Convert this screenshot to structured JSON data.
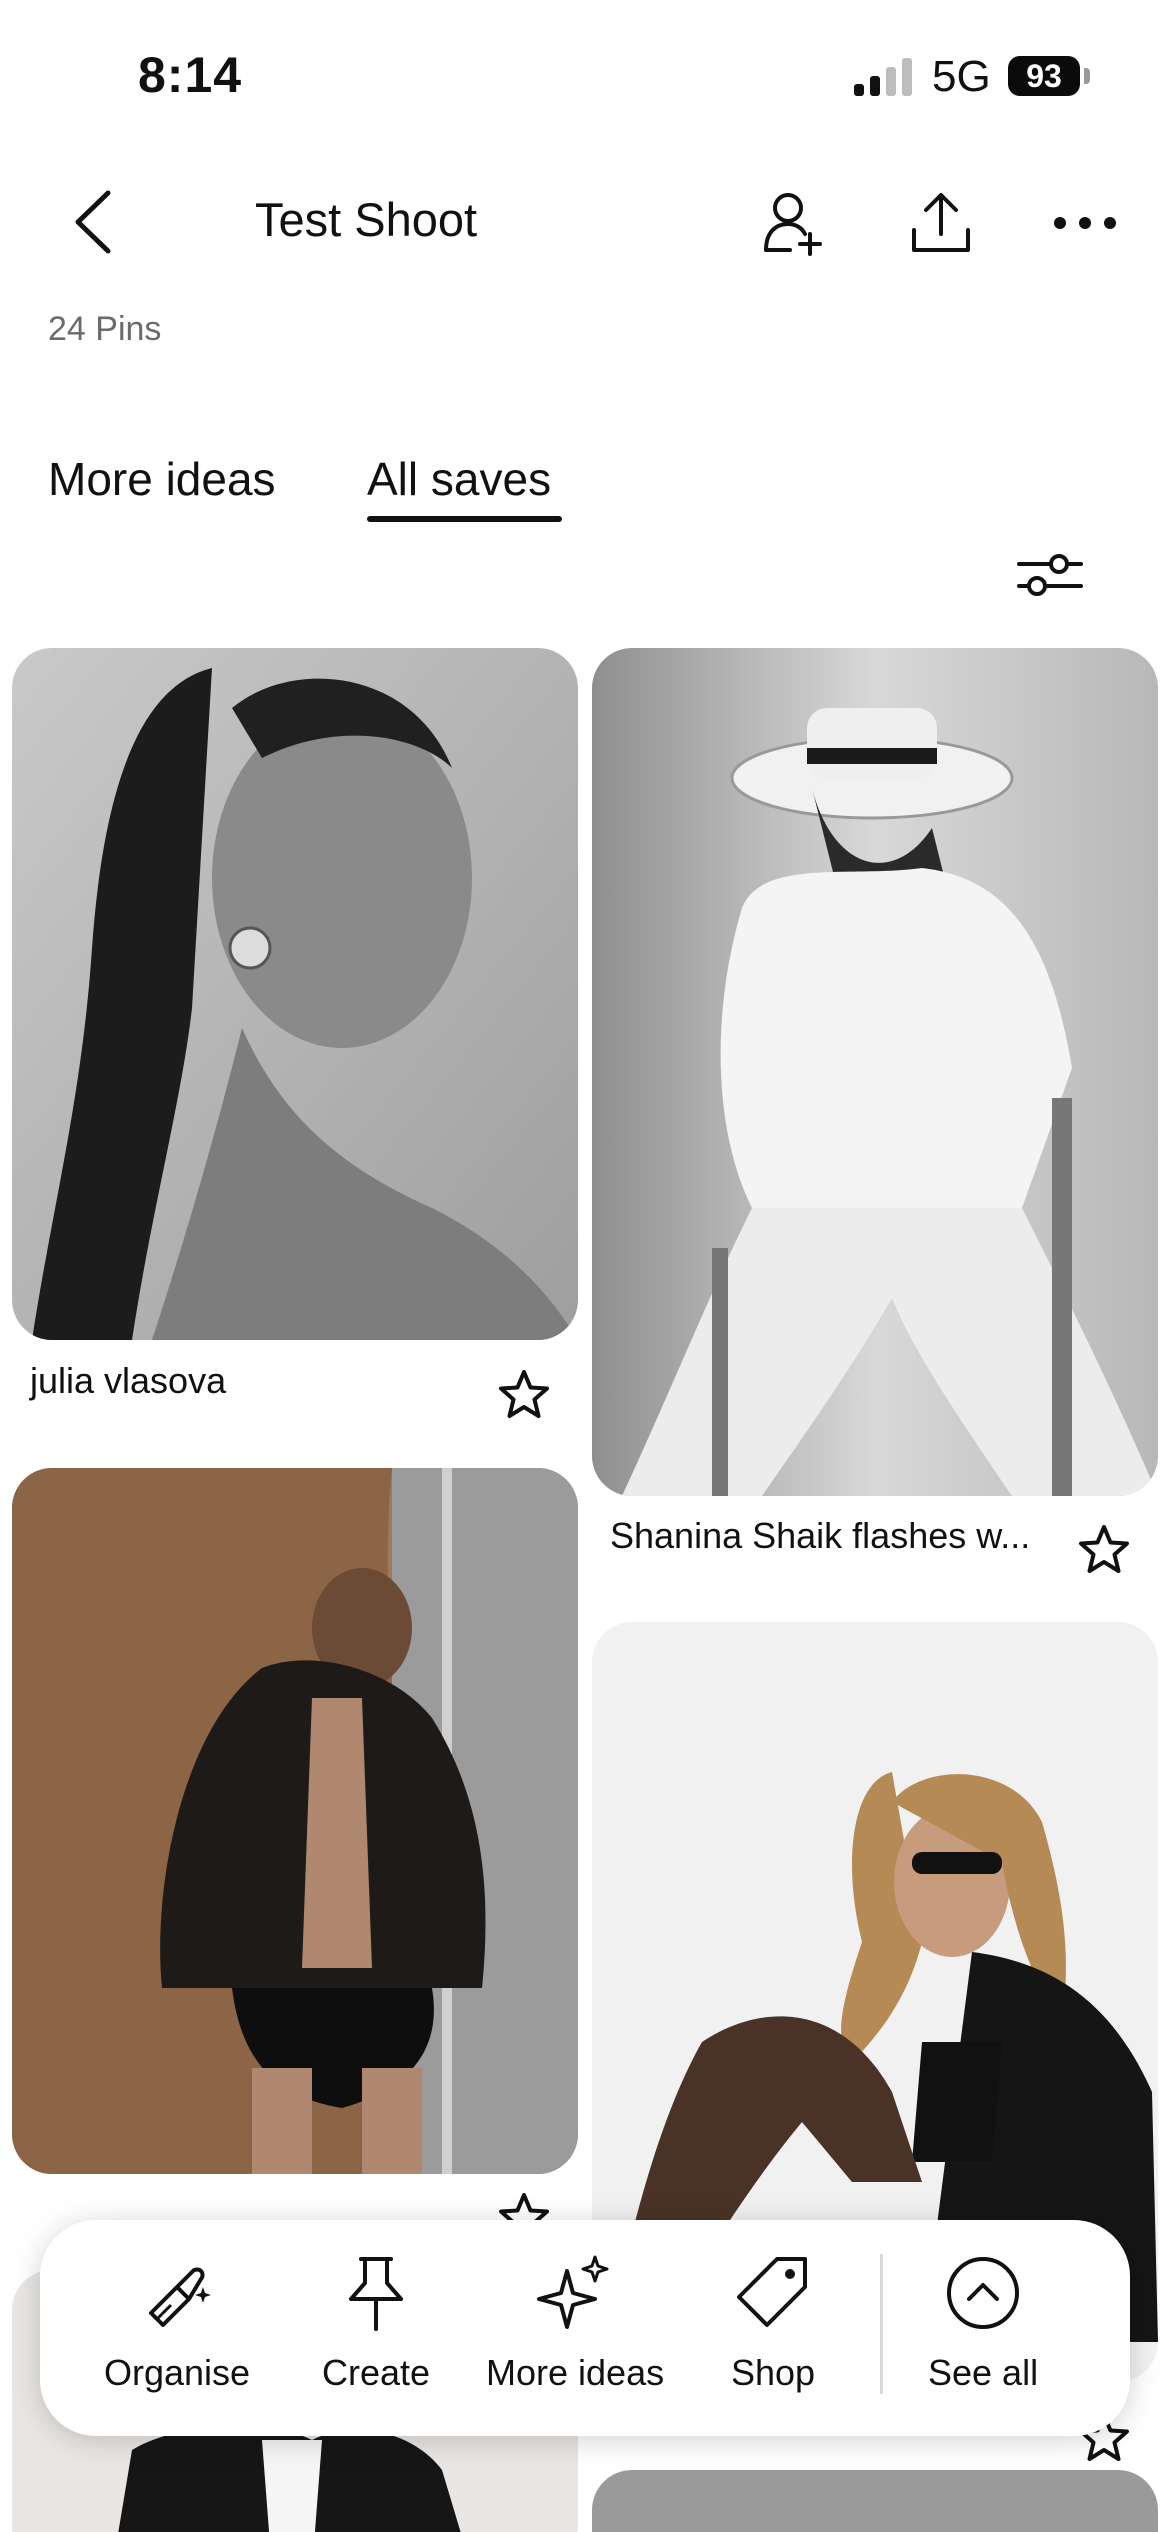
{
  "status_bar": {
    "time": "8:14",
    "network": "5G",
    "battery": "93"
  },
  "header": {
    "title": "Test Shoot",
    "pin_count": "24 Pins",
    "icons": [
      "back-icon",
      "add-collaborator-icon",
      "share-icon",
      "more-icon"
    ]
  },
  "tabs": [
    {
      "label": "More ideas",
      "active": false
    },
    {
      "label": "All saves",
      "active": true
    }
  ],
  "pins": [
    {
      "title": "julia vlasova"
    },
    {
      "title": "Shanina Shaik flashes w..."
    },
    {
      "title": ""
    },
    {
      "title": ""
    }
  ],
  "action_bar": {
    "items": [
      {
        "label": "Organise",
        "icon": "broom-sparkle-icon"
      },
      {
        "label": "Create",
        "icon": "pin-icon"
      },
      {
        "label": "More ideas",
        "icon": "sparkle-icon"
      },
      {
        "label": "Shop",
        "icon": "tag-icon"
      },
      {
        "label": "See all",
        "icon": "chevron-up-circle-icon"
      }
    ]
  },
  "colors": {
    "text": "#111111",
    "muted": "#6b6b6b",
    "background": "#ffffff"
  }
}
